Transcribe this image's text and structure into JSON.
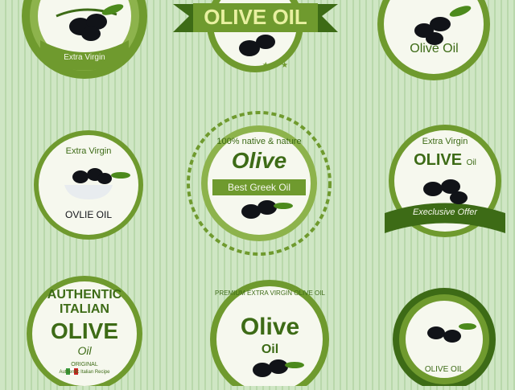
{
  "colors": {
    "background": "#c9e2bd",
    "olive_green": "#6f9a2e",
    "dark_green": "#3d6b16",
    "light_green": "#8db34c",
    "cream": "#f6f8ee",
    "olive_black": "#111318"
  },
  "badges": [
    {
      "id": "extra-virgin-top-left",
      "text": "Extra Virgin",
      "icon": "olive-branch-icon"
    },
    {
      "id": "olive-oil-ribbon",
      "text": "OLIVE OIL",
      "icon": "olive-branch-icon"
    },
    {
      "id": "olive-oil-top-right",
      "text": "Olive Oil",
      "icon": "olive-branch-icon"
    },
    {
      "id": "ovlie-oil",
      "top_text": "Extra Virgin",
      "bottom_text": "OVLIE OIL",
      "icon": "olive-bowl-icon"
    },
    {
      "id": "best-greek-oil",
      "arc_text": "100% native & nature",
      "title": "Olive",
      "banner": "Best Greek Oil",
      "icon": "olive-branch-icon"
    },
    {
      "id": "exclusive-offer",
      "top_text": "Extra Virgin",
      "title": "OLIVE",
      "title_suffix": "Oil",
      "ribbon": "Execlusive Offer",
      "icon": "olive-branch-icon"
    },
    {
      "id": "authentic-italian",
      "line1": "AUTHENTIC",
      "line2": "ITALIAN",
      "line3": "OLIVE",
      "script": "Oil",
      "small1": "ORIGINAL",
      "small2": "Authentic Italian Recipe",
      "icon": "italian-flag-icon"
    },
    {
      "id": "premium-extra-virgin",
      "arc_text": "PREMIUM EXTRA VIRGIN OLIVE OIL",
      "title": "Olive",
      "subtitle": "Oil",
      "icon": "olive-branch-icon"
    },
    {
      "id": "olive-oil-bottom-right",
      "text": "OLIVE OIL",
      "icon": "olive-branch-icon"
    }
  ]
}
